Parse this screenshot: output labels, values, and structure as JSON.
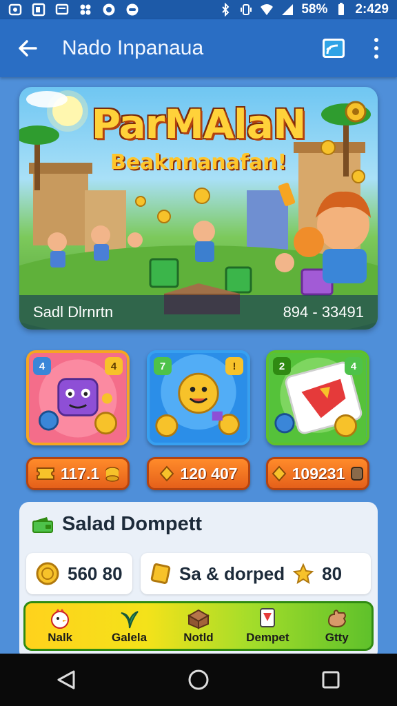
{
  "status_bar": {
    "left_icons": [
      "notification-icon",
      "photo-icon",
      "message-icon",
      "game-icon",
      "sync-icon",
      "circle-icon"
    ],
    "battery": "58%",
    "time": "2:429"
  },
  "app_bar": {
    "title": "Nado Inpanaua"
  },
  "banner": {
    "title": "ParMAlaN",
    "subtitle": "Beaknnanafan!",
    "footer_left": "Sadl Dlrnrtn",
    "footer_right": "894 - 33491"
  },
  "tiles": [
    {
      "badge_left": "4",
      "badge_right": "4",
      "price": "117.1"
    },
    {
      "badge_left": "7",
      "badge_right": "!",
      "price": "120 407"
    },
    {
      "badge_left": "2",
      "badge_right": "4",
      "price": "109231"
    }
  ],
  "panel": {
    "title": "Salad Dompett",
    "chip_left": "560 80",
    "chip_right_text": "Sa & dorped",
    "chip_right_value": "80",
    "nav": [
      {
        "label": "Nalk"
      },
      {
        "label": "Galela"
      },
      {
        "label": "Notld"
      },
      {
        "label": "Dempet"
      },
      {
        "label": "Gtty"
      }
    ]
  },
  "colors": {
    "background": "#4f8fd9",
    "app_bar": "#2a6ec4",
    "price_button": "#ff8b2a",
    "tile_border": "#f7a521"
  }
}
